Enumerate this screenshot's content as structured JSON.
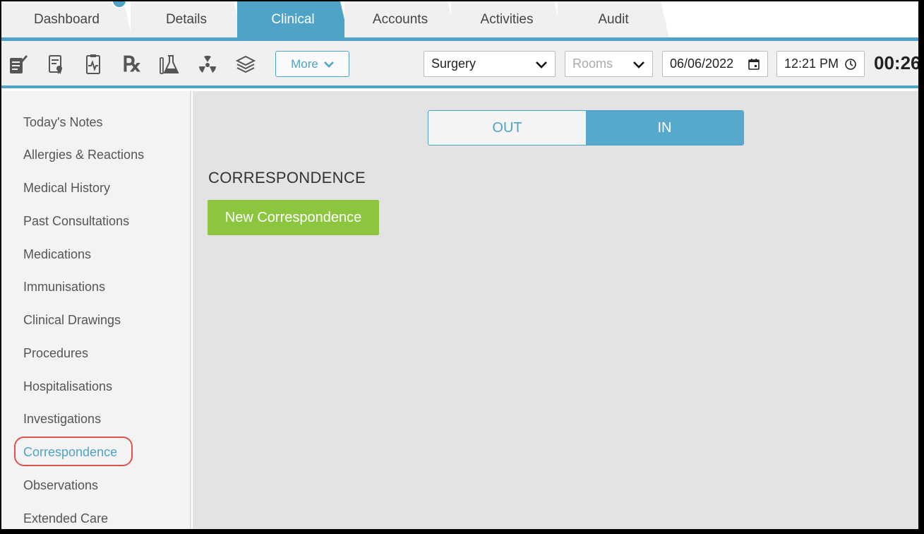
{
  "tabs": [
    {
      "label": "Dashboard",
      "active": false
    },
    {
      "label": "Details",
      "active": false
    },
    {
      "label": "Clinical",
      "active": true
    },
    {
      "label": "Accounts",
      "active": false
    },
    {
      "label": "Activities",
      "active": false
    },
    {
      "label": "Audit",
      "active": false
    }
  ],
  "toolbar": {
    "icons": [
      "notes-icon",
      "certificate-icon",
      "report-icon",
      "prescription-icon",
      "lab-flask-icon",
      "radiology-icon",
      "layers-icon"
    ],
    "rx_glyph": "℞",
    "more_label": "More",
    "location_select": "Surgery",
    "rooms_placeholder": "Rooms",
    "date": "06/06/2022",
    "time": "12:21 PM",
    "timer": "00:26"
  },
  "sidebar": {
    "items": [
      "Today's Notes",
      "Allergies & Reactions",
      "Medical History",
      "Past Consultations",
      "Medications",
      "Immunisations",
      "Clinical Drawings",
      "Procedures",
      "Hospitalisations",
      "Investigations",
      "Correspondence",
      "Observations",
      "Extended Care"
    ],
    "active_index": 10
  },
  "main": {
    "toggle": {
      "out": "OUT",
      "in": "IN",
      "selected": "IN"
    },
    "section_title": "CORRESPONDENCE",
    "new_button": "New Correspondence"
  },
  "colors": {
    "accent": "#4fa3c7",
    "green": "#8cc63f",
    "highlight_ring": "#d9534f"
  }
}
